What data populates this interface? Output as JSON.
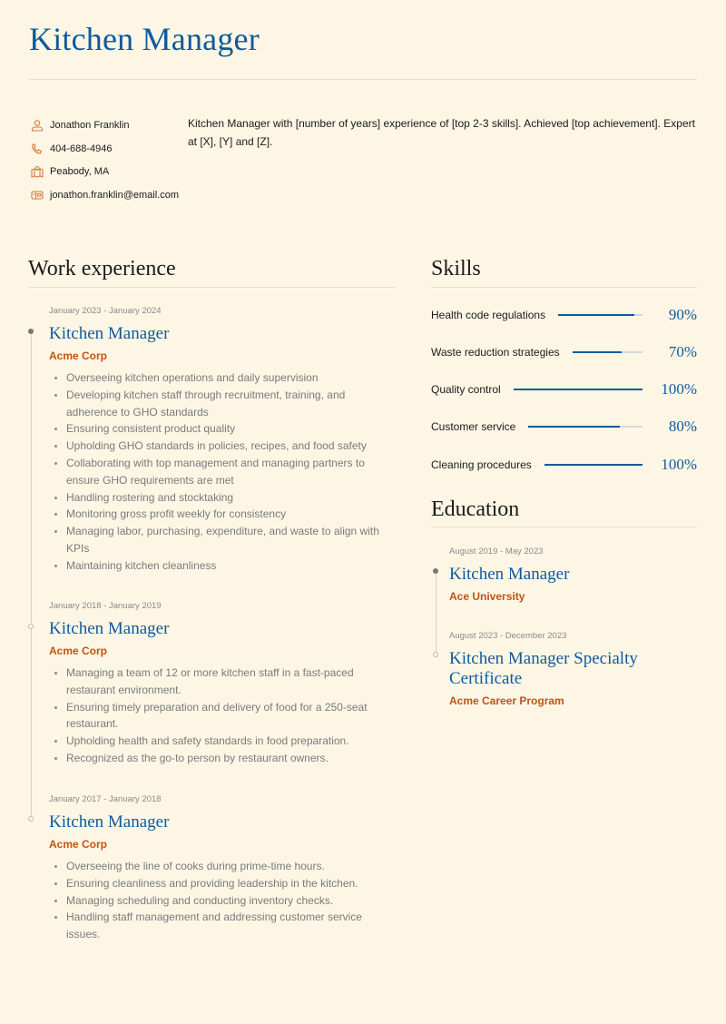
{
  "header": {
    "title": "Kitchen Manager"
  },
  "contacts": [
    {
      "icon": "user-icon",
      "value": "Jonathon Franklin"
    },
    {
      "icon": "phone-icon",
      "value": "404-688-4946"
    },
    {
      "icon": "map-icon",
      "value": "Peabody, MA"
    },
    {
      "icon": "mailbox-icon",
      "value": "jonathon.franklin@email.com"
    }
  ],
  "summary": "Kitchen Manager with [number of years] experience of [top 2-3 skills]. Achieved [top achievement]. Expert at [X], [Y] and [Z].",
  "work": {
    "title": "Work experience",
    "entries": [
      {
        "date": "January 2023 - January 2024",
        "role": "Kitchen Manager",
        "org": "Acme Corp",
        "bullets": [
          "Overseeing kitchen operations and daily supervision",
          "Developing kitchen staff through recruitment, training, and adherence to GHO standards",
          "Ensuring consistent product quality",
          "Upholding GHO standards in policies, recipes, and food safety",
          "Collaborating with top management and managing partners to ensure GHO requirements are met",
          "Handling rostering and stocktaking",
          "Monitoring gross profit weekly for consistency",
          "Managing labor, purchasing, expenditure, and waste to align with KPIs",
          "Maintaining kitchen cleanliness"
        ]
      },
      {
        "date": "January 2018 - January 2019",
        "role": "Kitchen Manager",
        "org": "Acme Corp",
        "bullets": [
          "Managing a team of 12 or more kitchen staff in a fast-paced restaurant environment.",
          "Ensuring timely preparation and delivery of food for a 250-seat restaurant.",
          "Upholding health and safety standards in food preparation.",
          "Recognized as the go-to person by restaurant owners."
        ]
      },
      {
        "date": "January 2017 - January 2018",
        "role": "Kitchen Manager",
        "org": "Acme Corp",
        "bullets": [
          "Overseeing the line of cooks during prime-time hours.",
          "Ensuring cleanliness and providing leadership in the kitchen.",
          "Managing scheduling and conducting inventory checks.",
          "Handling staff management and addressing customer service issues."
        ]
      }
    ]
  },
  "skills": {
    "title": "Skills",
    "items": [
      {
        "name": "Health code regulations",
        "level": 90,
        "label": "90%"
      },
      {
        "name": "Waste reduction strategies",
        "level": 70,
        "label": "70%"
      },
      {
        "name": "Quality control",
        "level": 100,
        "label": "100%"
      },
      {
        "name": "Customer service",
        "level": 80,
        "label": "80%"
      },
      {
        "name": "Cleaning procedures",
        "level": 100,
        "label": "100%"
      }
    ]
  },
  "education": {
    "title": "Education",
    "entries": [
      {
        "date": "August 2019 - May 2023",
        "degree": "Kitchen Manager",
        "school": "Ace University"
      },
      {
        "date": "August 2023 - December 2023",
        "degree": "Kitchen Manager Specialty Certificate",
        "school": "Acme Career Program"
      }
    ]
  },
  "colors": {
    "accent": "#0f5a9c",
    "org": "#c35311",
    "background": "#fdf6e5"
  }
}
